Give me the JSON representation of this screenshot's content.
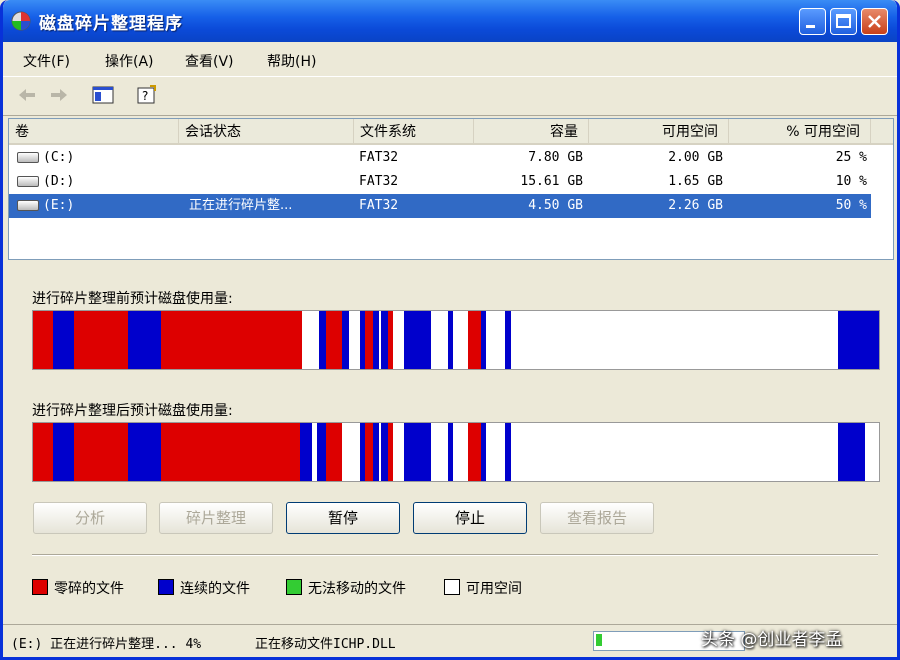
{
  "window": {
    "title": "磁盘碎片整理程序"
  },
  "menu": [
    {
      "label": "文件(F)"
    },
    {
      "label": "操作(A)"
    },
    {
      "label": "查看(V)"
    },
    {
      "label": "帮助(H)"
    }
  ],
  "toolbar": {
    "back_icon": "back-arrow-icon",
    "forward_icon": "forward-arrow-icon",
    "console_icon": "show-hide-console-tree-icon",
    "help_icon": "help-icon"
  },
  "volume_list": {
    "headers": [
      "卷",
      "会话状态",
      "文件系统",
      "容量",
      "可用空间",
      "% 可用空间"
    ],
    "rows": [
      {
        "volume": "(C:)",
        "status": "",
        "fs": "FAT32",
        "capacity": "7.80 GB",
        "free": "2.00 GB",
        "pct": "25 %",
        "selected": false
      },
      {
        "volume": "(D:)",
        "status": "",
        "fs": "FAT32",
        "capacity": "15.61 GB",
        "free": "1.65 GB",
        "pct": "10 %",
        "selected": false
      },
      {
        "volume": "(E:)",
        "status": "正在进行碎片整...",
        "fs": "FAT32",
        "capacity": "4.50 GB",
        "free": "2.26 GB",
        "pct": "50 %",
        "selected": true
      }
    ]
  },
  "analysis": {
    "before_label": "进行碎片整理前预计磁盘使用量:",
    "after_label": "进行碎片整理后预计磁盘使用量:"
  },
  "buttons": {
    "analyze": "分析",
    "defragment": "碎片整理",
    "pause": "暂停",
    "stop": "停止",
    "view_report": "查看报告"
  },
  "legend": {
    "fragmented": "零碎的文件",
    "contiguous": "连续的文件",
    "unmovable": "无法移动的文件",
    "free": "可用空间"
  },
  "colors": {
    "fragmented": "#dd0000",
    "contiguous": "#0000cc",
    "unmovable": "#33cc33",
    "free": "#ffffff"
  },
  "status": {
    "volume_progress": "(E:) 正在进行碎片整理... 4%",
    "moving_file": "正在移动文件ICHP.DLL",
    "progress_fraction": 0.04
  },
  "watermark": "头条 @创业者李孟"
}
